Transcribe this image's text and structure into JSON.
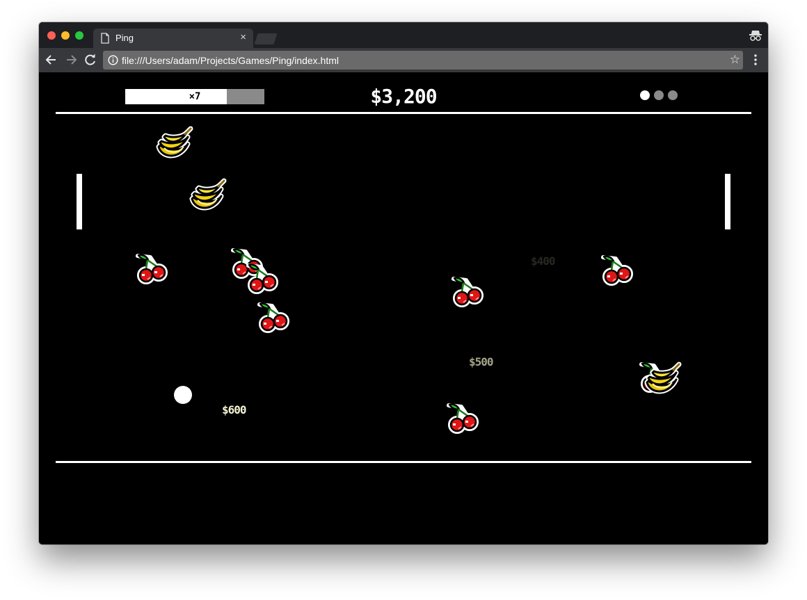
{
  "browser": {
    "tab_title": "Ping",
    "tab_close": "×",
    "url": "file:///Users/adam/Projects/Games/Ping/index.html",
    "bookmark_star": "☆"
  },
  "game": {
    "combo_label": "×7",
    "combo_progress": 0.73,
    "score": "$3,200",
    "lives_total": 3,
    "lives_remaining": 1,
    "point_popups": [
      {
        "text": "$400",
        "opacity": 0.18,
        "color": "#dcdcb8"
      },
      {
        "text": "$500",
        "opacity": 0.75,
        "color": "#dcdcb8"
      },
      {
        "text": "$600",
        "opacity": 1.0,
        "color": "#f4f4d4"
      }
    ],
    "fruits": [
      "banana",
      "banana",
      "cherries",
      "cherries",
      "cherries",
      "cherries",
      "cherries",
      "cherries",
      "cherries",
      "banana"
    ],
    "colors": {
      "banana": "#f2d214",
      "cherry": "#e01616",
      "stem": "#2fc52f",
      "outline": "#ffffff"
    }
  }
}
